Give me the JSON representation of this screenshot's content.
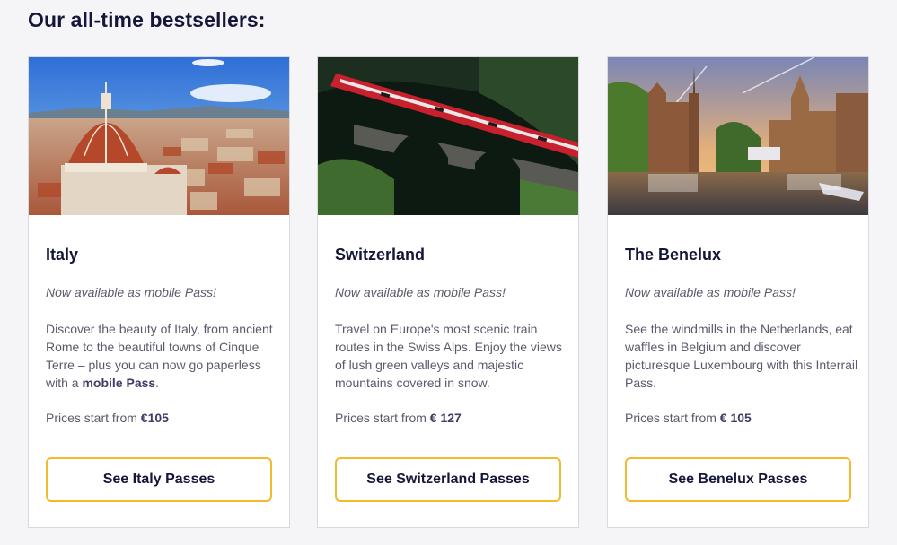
{
  "heading": "Our all-time bestsellers:",
  "cards": [
    {
      "title": "Italy",
      "tagline": "Now available as mobile Pass!",
      "description": "Discover the beauty of Italy, from ancient Rome to the beautiful towns of Cinque Terre – plus you can now go paperless with a ",
      "description_bold": "mobile Pass",
      "description_end": ".",
      "price_prefix": "Prices start from ",
      "price": "€105",
      "button": "See Italy Passes"
    },
    {
      "title": "Switzerland",
      "tagline": "Now available as mobile Pass!",
      "description": "Travel on Europe's most scenic train routes in the Swiss Alps. Enjoy the views of lush green valleys and majestic mountains covered in snow.",
      "price_prefix": "Prices start from ",
      "price": "€ 127",
      "button": "See Switzerland Passes"
    },
    {
      "title": "The Benelux",
      "tagline": "Now available as mobile Pass!",
      "description": "See the windmills in the Netherlands, eat waffles in Belgium and discover picturesque Luxembourg with this Interrail Pass.",
      "price_prefix": "Prices start from ",
      "price": "€ 105",
      "button": "See Benelux Passes"
    }
  ],
  "colors": {
    "button_border": "#f5b92e",
    "heading": "#16163a",
    "body_text": "#5a5a6e"
  }
}
